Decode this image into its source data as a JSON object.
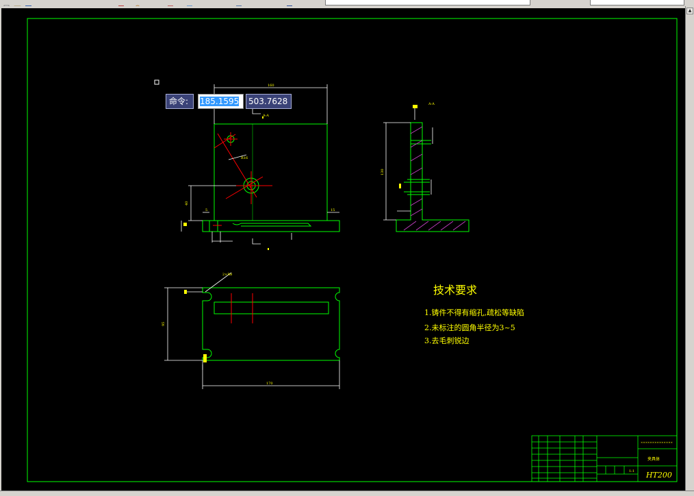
{
  "toolbar": {
    "buttons": [
      "new-icon",
      "open-icon",
      "save-icon",
      "undo-icon",
      "redo-icon",
      "pan-icon",
      "zoom-icon",
      "properties-icon",
      "match-icon",
      "print-icon",
      "preview-icon",
      "help-icon"
    ],
    "layer_combo_value": "",
    "style_combo_value": ""
  },
  "dynamic_input": {
    "label": "命令:",
    "x_value": "185.1595",
    "y_value": "503.7628"
  },
  "drawing": {
    "front_width_dim": "160",
    "height_dim_left": "40",
    "dim_small_right": "15",
    "dim_small_left": "5",
    "dim_radius": "R16",
    "side_height_dim": "130",
    "plan_width_dim": "170",
    "plan_height_dim": "95",
    "plan_radius_label": "2×R8",
    "section_label": "A-A",
    "tech_title": "技术要求",
    "tech_notes": [
      "1.铸件不得有缩孔,疏松等缺陷",
      "2.未标注的圆角半径为3~5",
      "3.去毛刺锐边"
    ]
  },
  "title_block": {
    "material": "HT200",
    "drawing_name": "夹具体",
    "school": "××××××××××××××",
    "scale": "1:1"
  },
  "colors": {
    "border": "#00ff00",
    "lines": "#00ff00",
    "dims": "#ffffff",
    "center": "#ff0000",
    "hatch": "#cc44cc",
    "text": "#ffff00"
  }
}
